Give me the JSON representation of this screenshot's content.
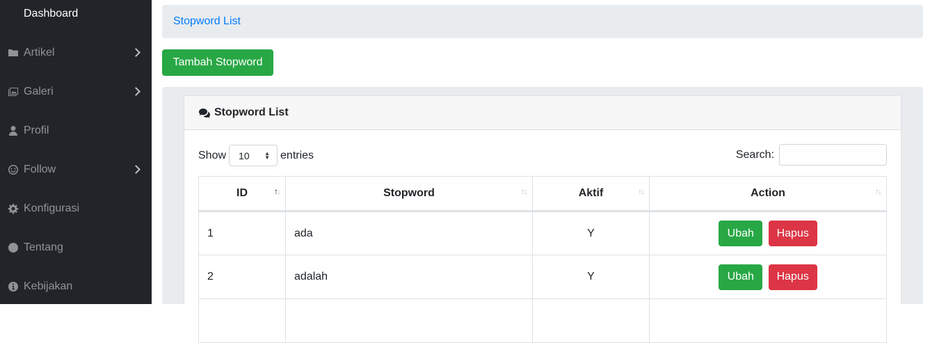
{
  "sidebar": {
    "items": [
      {
        "label": "Dashboard",
        "icon": "dashboard-icon",
        "active": true
      },
      {
        "label": "Artikel",
        "icon": "folder-icon",
        "submenu": true
      },
      {
        "label": "Galeri",
        "icon": "images-icon",
        "submenu": true
      },
      {
        "label": "Profil",
        "icon": "user-icon"
      },
      {
        "label": "Follow",
        "icon": "smile-icon",
        "submenu": true
      },
      {
        "label": "Konfigurasi",
        "icon": "cog-icon"
      },
      {
        "label": "Tentang",
        "icon": "globe-icon"
      },
      {
        "label": "Kebijakan",
        "icon": "info-icon"
      }
    ]
  },
  "breadcrumb": {
    "label": "Stopword List"
  },
  "add_button": {
    "label": "Tambah Stopword"
  },
  "card": {
    "title": "Stopword List",
    "icon": "comments-icon"
  },
  "length_control": {
    "prefix": "Show",
    "value": "10",
    "suffix": "entries"
  },
  "search": {
    "label": "Search:",
    "value": ""
  },
  "table": {
    "columns": [
      "ID",
      "Stopword",
      "Aktif",
      "Action"
    ],
    "rows": [
      {
        "id": "1",
        "stopword": "ada",
        "aktif": "Y"
      },
      {
        "id": "2",
        "stopword": "adalah",
        "aktif": "Y"
      }
    ],
    "edit_label": "Ubah",
    "delete_label": "Hapus"
  },
  "colors": {
    "sidebar_bg": "#212529",
    "success": "#28a745",
    "danger": "#dc3545",
    "link": "#007bff"
  }
}
